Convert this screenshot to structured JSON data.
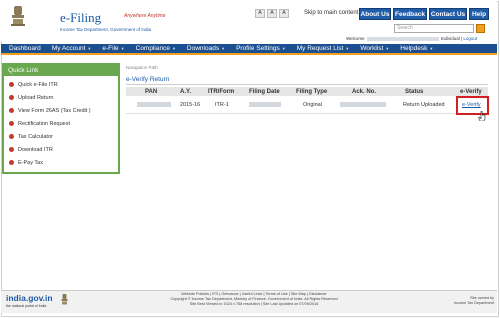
{
  "header": {
    "brand": "e-Filing",
    "brand_tag": "Anywhere Anytime",
    "brand_sub": "Income Tax Department, Government of India",
    "font_small": "A",
    "font_mid": "A",
    "font_large": "A",
    "skip": "Skip to main content",
    "buttons": [
      "About Us",
      "Feedback",
      "Contact Us",
      "Help"
    ],
    "search_placeholder": "Search",
    "welcome_prefix": "Welcome",
    "welcome_role": "Individual",
    "logout": "Logout"
  },
  "nav": {
    "items": [
      "Dashboard",
      "My Account",
      "e-File",
      "Compliance",
      "Downloads",
      "Profile Settings",
      "My Request List",
      "Worklist",
      "Helpdesk"
    ]
  },
  "quick_links": {
    "title": "Quick Link",
    "items": [
      "Quick e-File ITR",
      "Upload Return",
      "View Form 26AS (Tax Credit )",
      "Rectification Request",
      "Tax Calculator",
      "Download ITR",
      "E-Pay Tax"
    ]
  },
  "main": {
    "breadcrumb": "Navigation Path",
    "title": "e-Verify Return",
    "columns": [
      "PAN",
      "A.Y.",
      "ITR/Form",
      "Filing Date",
      "Filing Type",
      "Ack. No.",
      "Status",
      "e-Verify"
    ],
    "row": {
      "ay": "2015-16",
      "form": "ITR-1",
      "filing_type": "Original",
      "status": "Return Uploaded",
      "action": "e-Verify"
    }
  },
  "footer": {
    "logo": "india.gov.in",
    "logo_sub": "the national portal of India",
    "links": "Website Policies  |  RTI  |  Grievance  |  Useful Links  |  Terms of Use  |  Site Map  |  Disclaimer",
    "copyright": "Copyright © Income Tax Department, Ministry of Finance, Government of India. All Rights Reserved",
    "best_viewed": "Site Best Viewed in 1024 x 768 resolution  |  Site Last Updated on 07/09/2016",
    "owned_by": "Site owned by",
    "owned_by_org": "Income Tax Department"
  },
  "colors": {
    "nav": "#1c4f8f",
    "accent": "#f0a020",
    "quick_link": "#6aa84f",
    "highlight": "#d21f1f"
  }
}
